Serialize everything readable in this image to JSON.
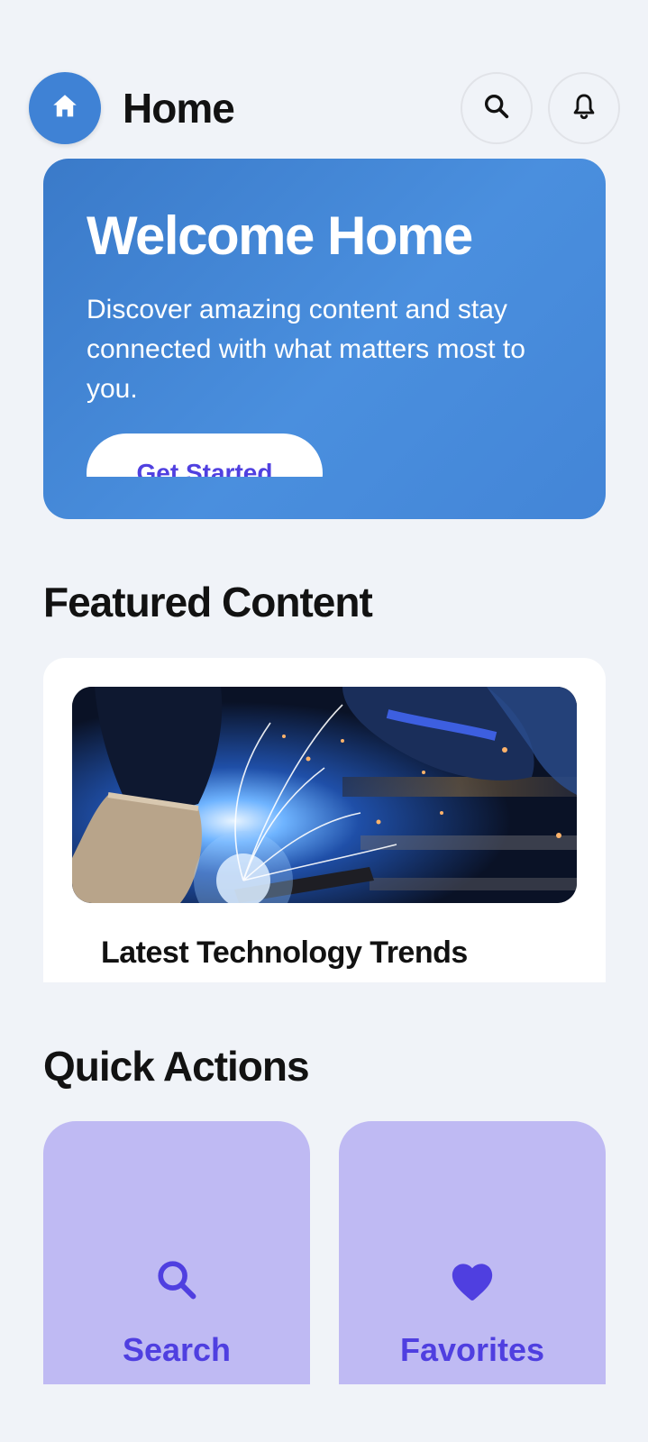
{
  "header": {
    "title": "Home",
    "home_icon": "home-icon",
    "search_icon": "search-icon",
    "notifications_icon": "bell-icon"
  },
  "hero": {
    "title": "Welcome Home",
    "description": "Discover amazing content and stay connected with what matters most to you.",
    "cta_label": "Get Started"
  },
  "featured": {
    "section_title": "Featured Content",
    "card": {
      "image": "welding-sparks-photo",
      "title": "Latest Technology Trends"
    }
  },
  "quick_actions": {
    "section_title": "Quick Actions",
    "items": [
      {
        "label": "Search",
        "icon": "search-icon"
      },
      {
        "label": "Favorites",
        "icon": "heart-icon"
      }
    ]
  },
  "colors": {
    "background": "#F0F3F8",
    "primary_blue": "#3F82D5",
    "accent_purple": "#4F3FE0",
    "tile_lavender": "#BFBAF3",
    "text_dark": "#121212"
  }
}
